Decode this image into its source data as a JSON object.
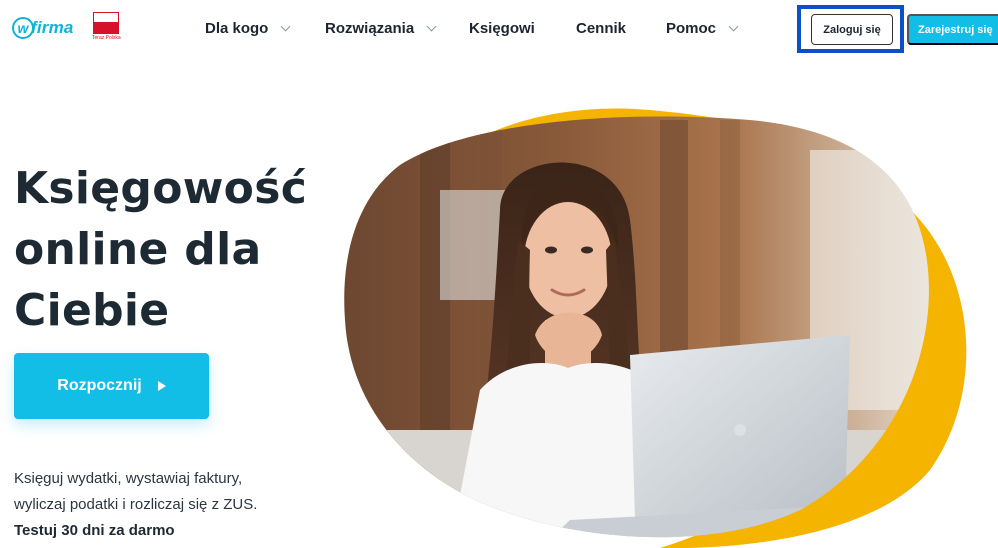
{
  "header": {
    "logo_text": "firma",
    "logo_letter": "w",
    "badge_caption": "Teraz Polska",
    "nav": [
      {
        "label": "Dla kogo",
        "has_dropdown": true
      },
      {
        "label": "Rozwiązania",
        "has_dropdown": true
      },
      {
        "label": "Księgowi",
        "has_dropdown": false
      },
      {
        "label": "Cennik",
        "has_dropdown": false
      },
      {
        "label": "Pomoc",
        "has_dropdown": true
      }
    ],
    "login_label": "Zaloguj się",
    "register_label": "Zarejestruj się"
  },
  "hero": {
    "title_lines": [
      "Księgowość",
      "online dla",
      "Ciebie"
    ],
    "cta_label": "Rozpocznij",
    "description_lines": [
      "Księguj wydatki, wystawiaj faktury,",
      "wyliczaj podatki i rozliczaj się z ZUS."
    ],
    "trial_text": "Testuj 30 dni za darmo"
  },
  "colors": {
    "brand": "#12bde6",
    "highlight": "#0b4fc9",
    "accent_blob": "#f4b400",
    "badge_red": "#d5122a"
  },
  "icons": {
    "logo": "wfirma-logo-icon",
    "badge": "teraz-polska-badge-icon",
    "dropdown": "chevron-down-icon",
    "cta": "play-arrow-icon"
  }
}
